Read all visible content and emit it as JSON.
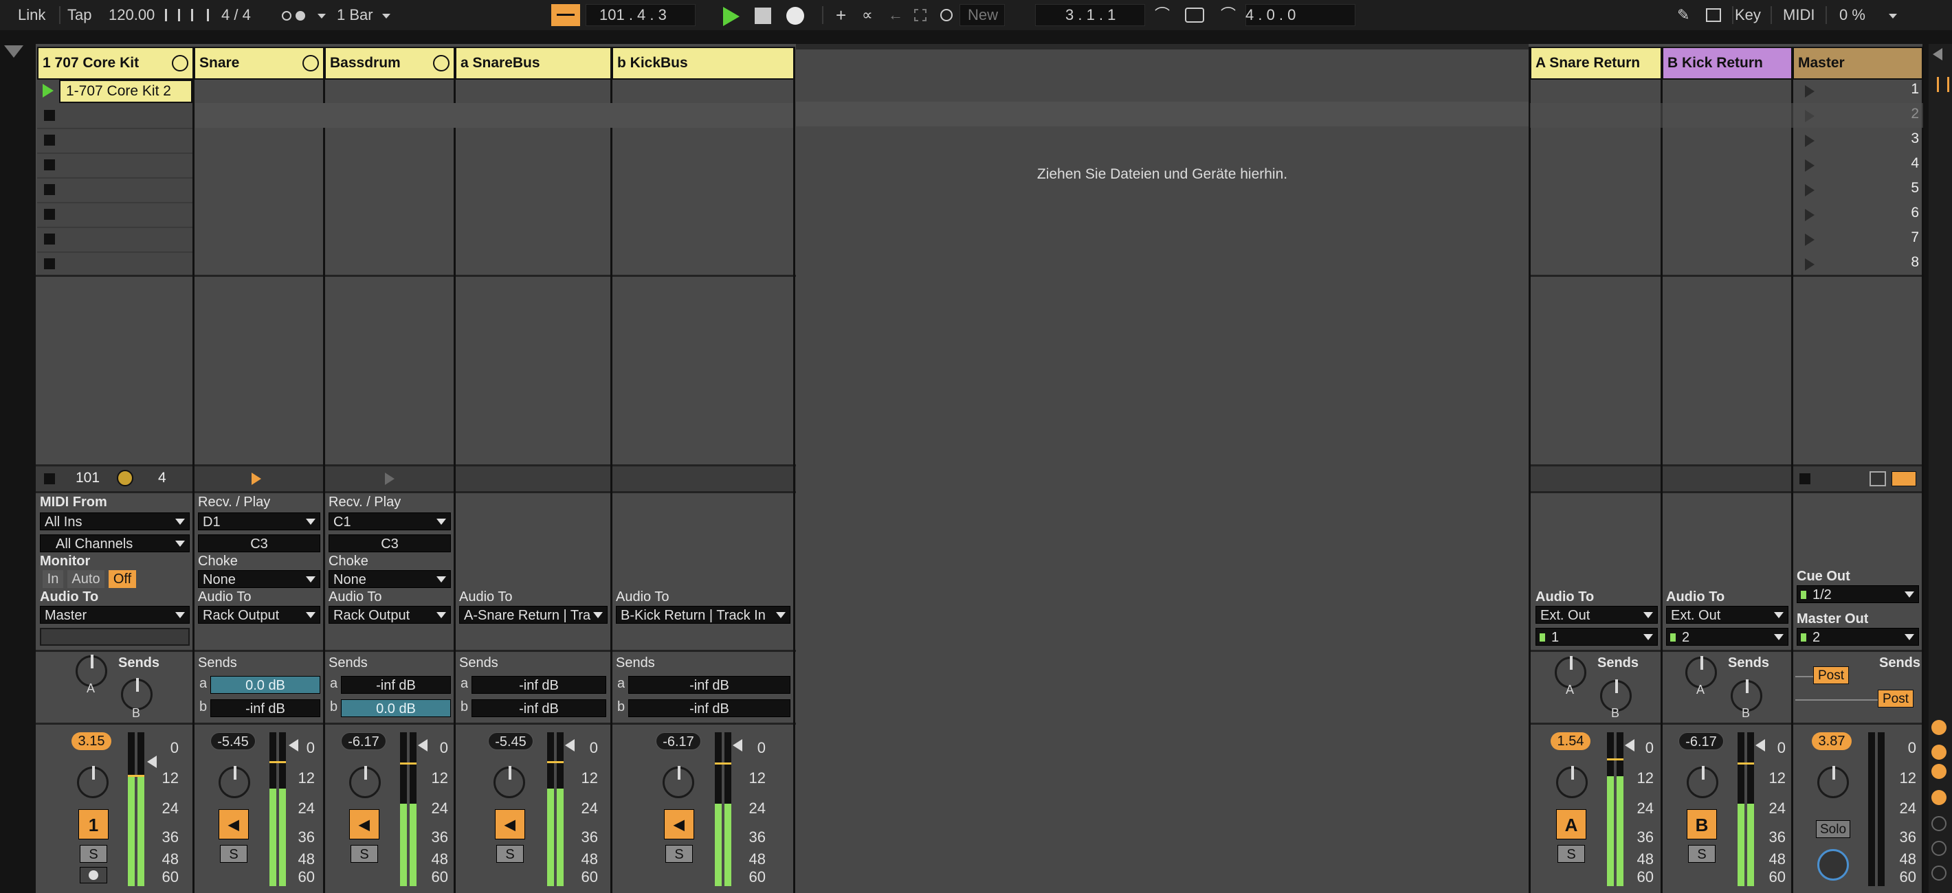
{
  "transport": {
    "link": "Link",
    "tap": "Tap",
    "tempo": "120.00",
    "signature": "4 / 4",
    "quantization": "1 Bar",
    "position": "101 .  4 .  3",
    "new_label": "New",
    "loop_start": "3 .  1 .  1",
    "loop_length": "4 .  0 .  0",
    "key_label": "Key",
    "midi_label": "MIDI",
    "cpu": "0 %"
  },
  "tracks": [
    {
      "name": "1 707 Core Kit",
      "clip": "1-707 Core Kit 2"
    },
    {
      "name": "Snare"
    },
    {
      "name": "Bassdrum"
    },
    {
      "name": "a SnareBus"
    },
    {
      "name": "b KickBus"
    }
  ],
  "returns": [
    {
      "name": "A Snare Return"
    },
    {
      "name": "B Kick Return"
    },
    {
      "name": "Master"
    }
  ],
  "scenes": [
    "1",
    "2",
    "3",
    "4",
    "5",
    "6",
    "7",
    "8"
  ],
  "drop_hint": "Ziehen Sie Dateien und Geräte hierhin.",
  "status_row": {
    "bar": "101",
    "beats": "4"
  },
  "io": {
    "midi_from": "MIDI From",
    "all_ins": "All Ins",
    "all_channels": "All Channels",
    "monitor": "Monitor",
    "mon_in": "In",
    "mon_auto": "Auto",
    "mon_off": "Off",
    "audio_to": "Audio To",
    "master": "Master",
    "recv_play": "Recv. / Play",
    "d1": "D1",
    "c1": "C1",
    "c3": "C3",
    "choke": "Choke",
    "none": "None",
    "rack_output": "Rack Output",
    "a_snare_return": "A-Snare Return | Tra",
    "b_kick_return": "B-Kick Return | Track In",
    "ext_out": "Ext. Out",
    "ch1": "1",
    "ch2": "2",
    "cue_out": "Cue Out",
    "cue_val": "1/2",
    "master_out": "Master Out",
    "master_out_val": "2"
  },
  "sends": {
    "label": "Sends",
    "a": "a",
    "b": "b",
    "zero_db": "0.0 dB",
    "inf_db": "-inf dB",
    "knob_a": "A",
    "knob_b": "B",
    "post": "Post"
  },
  "mixer": {
    "volumes": [
      "3.15",
      "-5.45",
      "-6.17",
      "-5.45",
      "-6.17",
      "1.54",
      "-6.17",
      "3.87"
    ],
    "ticks": [
      "0",
      "12",
      "24",
      "36",
      "48",
      "60"
    ],
    "track1_number": "1",
    "solo": "S",
    "return_a": "A",
    "return_b": "B",
    "solo_master": "Solo"
  },
  "colors": {
    "track_header": "#f2eb95",
    "return_a": "#f2eb95",
    "return_b": "#c08ad8",
    "master": "#b4915a",
    "accent": "#f0a040",
    "play_green": "#5dd03a"
  }
}
